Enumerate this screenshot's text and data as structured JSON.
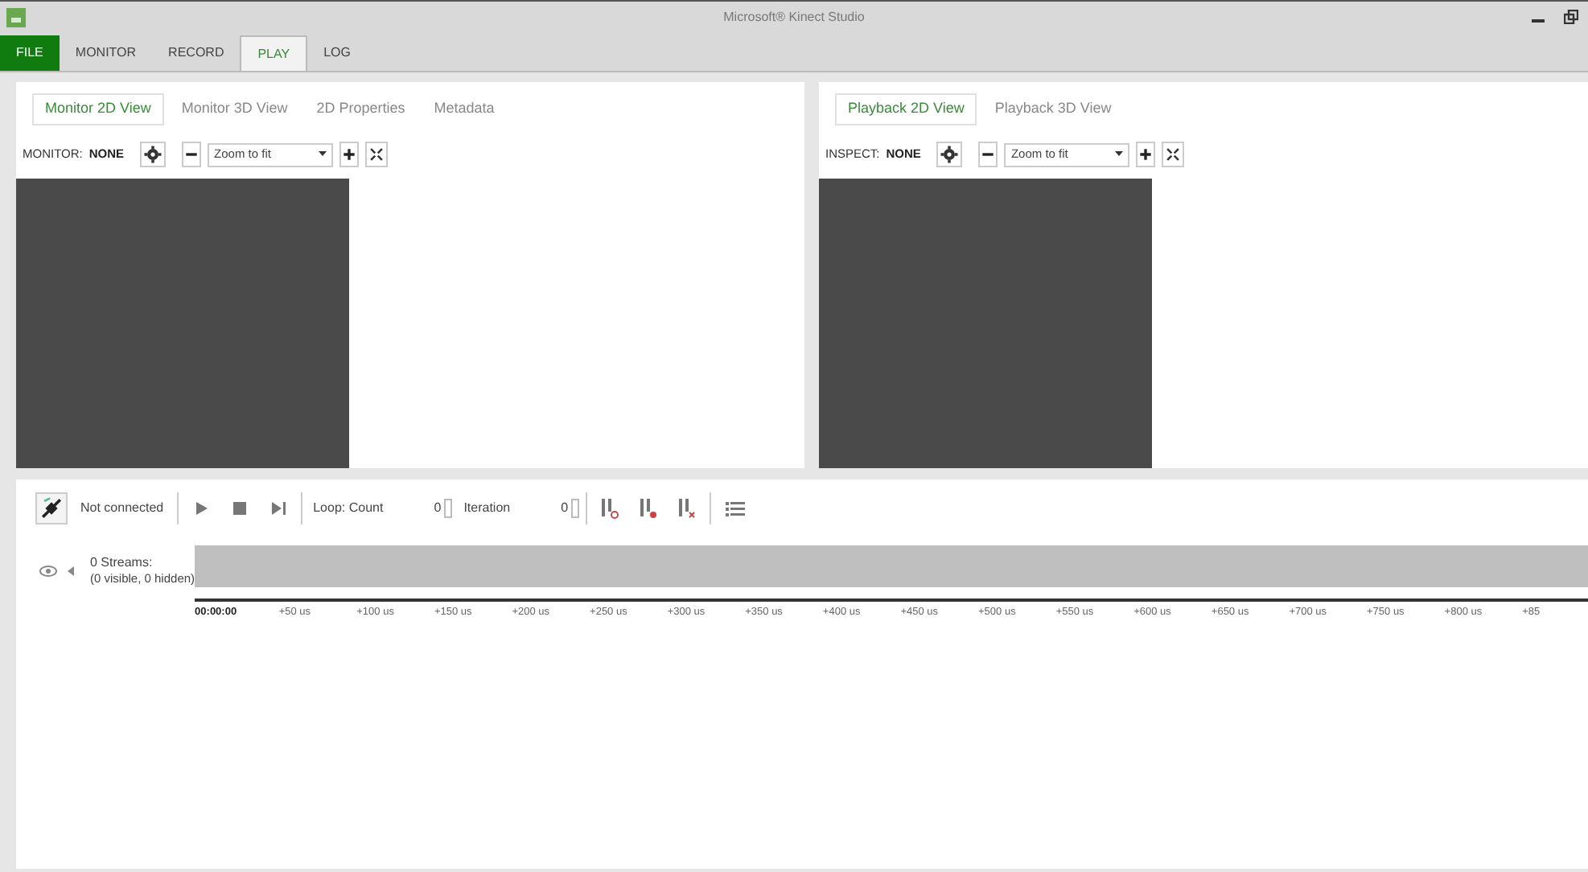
{
  "window": {
    "title": "Microsoft® Kinect Studio"
  },
  "menu_tabs": [
    {
      "label": "FILE",
      "kind": "file",
      "selected": false
    },
    {
      "label": "MONITOR",
      "kind": "tab",
      "selected": false
    },
    {
      "label": "RECORD",
      "kind": "tab",
      "selected": false
    },
    {
      "label": "PLAY",
      "kind": "tab",
      "selected": true
    },
    {
      "label": "LOG",
      "kind": "tab",
      "selected": false
    }
  ],
  "panels": [
    {
      "tabs": [
        {
          "label": "Monitor 2D View",
          "selected": true
        },
        {
          "label": "Monitor 3D View",
          "selected": false
        },
        {
          "label": "2D Properties",
          "selected": false
        },
        {
          "label": "Metadata",
          "selected": false
        }
      ],
      "source_label": "MONITOR:",
      "source_value": "NONE",
      "zoom": "Zoom to fit"
    },
    {
      "tabs": [
        {
          "label": "Playback 2D View",
          "selected": true
        },
        {
          "label": "Playback 3D View",
          "selected": false
        }
      ],
      "source_label": "INSPECT:",
      "source_value": "NONE",
      "zoom": "Zoom to fit"
    }
  ],
  "playback": {
    "connection": "Not connected",
    "loop_label": "Loop: Count",
    "loop_count": "0",
    "iteration_label": "Iteration",
    "iteration": "0"
  },
  "streams": {
    "title": "0 Streams:",
    "detail": "(0 visible, 0 hidden)"
  },
  "timeline": {
    "ticks": [
      "00:00:00",
      "+50 us",
      "+100 us",
      "+150 us",
      "+200 us",
      "+250 us",
      "+300 us",
      "+350 us",
      "+400 us",
      "+450 us",
      "+500 us",
      "+550 us",
      "+600 us",
      "+650 us",
      "+700 us",
      "+750 us",
      "+800 us",
      "+85"
    ]
  }
}
